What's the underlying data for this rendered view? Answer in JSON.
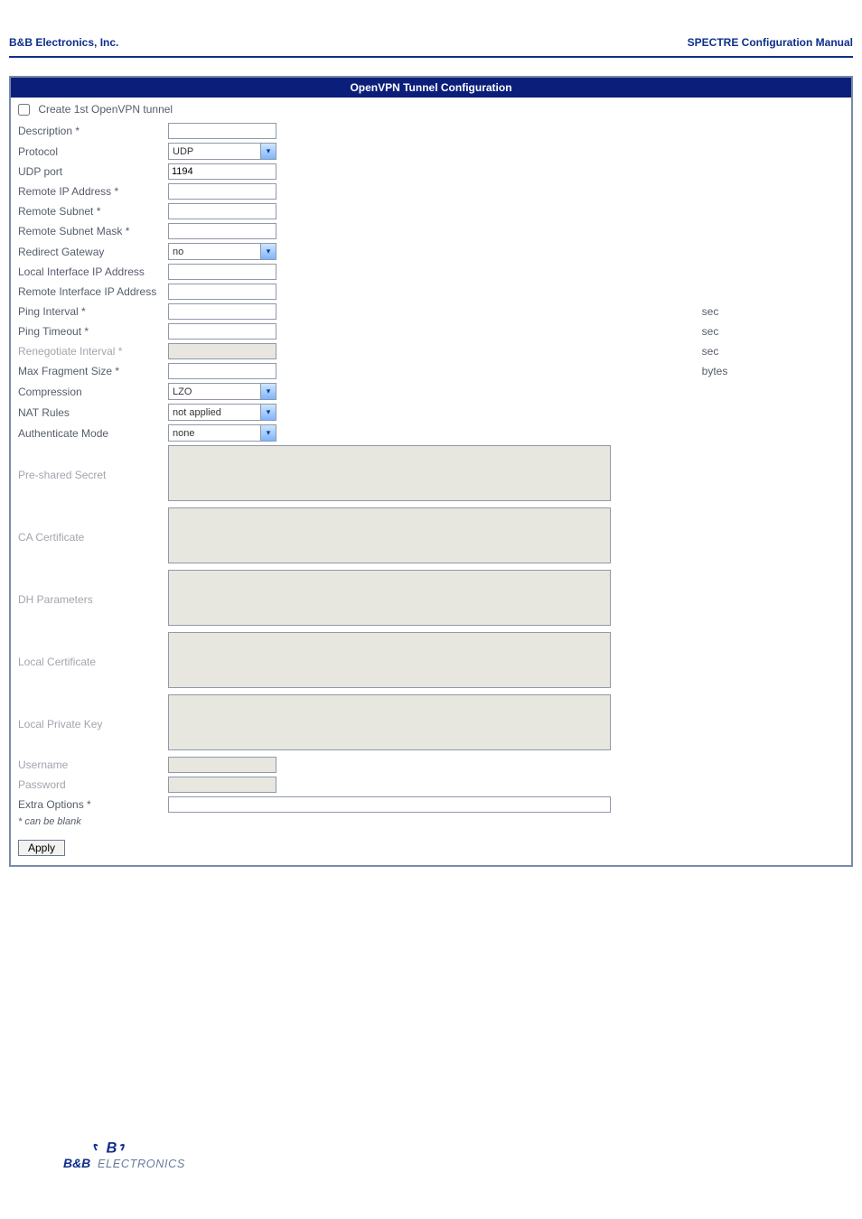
{
  "header": {
    "left": "B&B Electronics, Inc.",
    "right": "SPECTRE Configuration Manual"
  },
  "panel": {
    "title": "OpenVPN Tunnel Configuration",
    "checkbox_label": "Create 1st OpenVPN tunnel",
    "fields": {
      "description": {
        "label": "Description *",
        "value": ""
      },
      "protocol": {
        "label": "Protocol",
        "value": "UDP"
      },
      "udp_port": {
        "label": "UDP port",
        "value": "1194"
      },
      "remote_ip": {
        "label": "Remote IP Address *",
        "value": ""
      },
      "remote_subnet": {
        "label": "Remote Subnet *",
        "value": ""
      },
      "remote_subnet_mask": {
        "label": "Remote Subnet Mask *",
        "value": ""
      },
      "redirect_gateway": {
        "label": "Redirect Gateway",
        "value": "no"
      },
      "local_if_ip": {
        "label": "Local Interface IP Address",
        "value": ""
      },
      "remote_if_ip": {
        "label": "Remote Interface IP Address",
        "value": ""
      },
      "ping_interval": {
        "label": "Ping Interval *",
        "value": "",
        "unit": "sec"
      },
      "ping_timeout": {
        "label": "Ping Timeout *",
        "value": "",
        "unit": "sec"
      },
      "renegotiate": {
        "label": "Renegotiate Interval *",
        "value": "",
        "unit": "sec",
        "disabled": true
      },
      "max_fragment": {
        "label": "Max Fragment Size *",
        "value": "",
        "unit": "bytes"
      },
      "compression": {
        "label": "Compression",
        "value": "LZO"
      },
      "nat_rules": {
        "label": "NAT Rules",
        "value": "not applied"
      },
      "auth_mode": {
        "label": "Authenticate Mode",
        "value": "none"
      },
      "preshared": {
        "label": "Pre-shared Secret",
        "value": "",
        "disabled": true
      },
      "ca_cert": {
        "label": "CA Certificate",
        "value": "",
        "disabled": true
      },
      "dh_params": {
        "label": "DH Parameters",
        "value": "",
        "disabled": true
      },
      "local_cert": {
        "label": "Local Certificate",
        "value": "",
        "disabled": true
      },
      "local_key": {
        "label": "Local Private Key",
        "value": "",
        "disabled": true
      },
      "username": {
        "label": "Username",
        "value": "",
        "disabled": true
      },
      "password": {
        "label": "Password",
        "value": "",
        "disabled": true
      },
      "extra_opts": {
        "label": "Extra Options *",
        "value": ""
      }
    },
    "footnote": "* can be blank",
    "apply": "Apply"
  },
  "logo": {
    "text_top": "B&B",
    "text_bottom": "ELECTRONICS"
  }
}
